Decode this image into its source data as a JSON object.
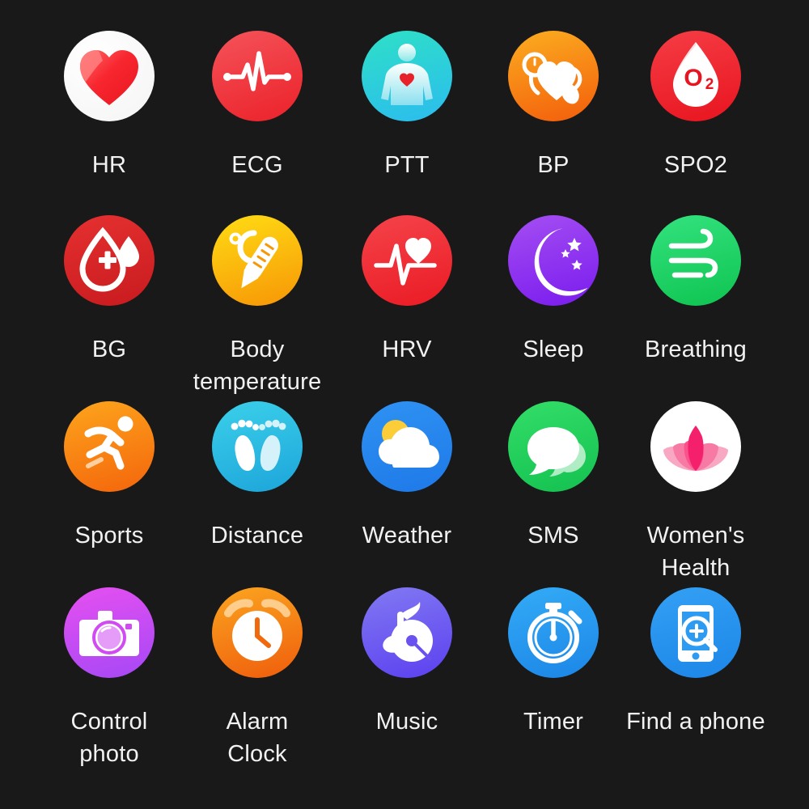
{
  "screen": {
    "title": "Smartwatch Feature Icon Grid",
    "background_color": "#191919",
    "label_color": "#f2f2f2",
    "columns": 5,
    "rows": 4
  },
  "items": [
    {
      "label": "HR",
      "icon": "heart-icon",
      "circle_colors": [
        "#ffffff",
        "#f2f2f2"
      ],
      "glyph_color": "#f42a32"
    },
    {
      "label": "ECG",
      "icon": "ecg-waveform-icon",
      "circle_colors": [
        "#f4464c",
        "#ec2b34"
      ],
      "glyph_color": "#ffffff"
    },
    {
      "label": "PTT",
      "icon": "body-torso-heart-icon",
      "circle_colors": [
        "#2fd9c8",
        "#2ec5ef"
      ],
      "glyph_color": "#ffffff"
    },
    {
      "label": "BP",
      "icon": "blood-pressure-cuff-heart-icon",
      "circle_colors": [
        "#f7a61b",
        "#f4640d"
      ],
      "glyph_color": "#ffffff"
    },
    {
      "label": "SPO2",
      "icon": "oxygen-droplet-icon",
      "circle_colors": [
        "#f4333c",
        "#ea1c27"
      ],
      "glyph_color": "#ffffff"
    },
    {
      "label": "BG",
      "icon": "blood-glucose-droplet-icon",
      "circle_colors": [
        "#e02c2c",
        "#cc1f22"
      ],
      "glyph_color": "#ffffff"
    },
    {
      "label": "Body\ntemperature",
      "icon": "thermometer-icon",
      "circle_colors": [
        "#ffd815",
        "#f79b06"
      ],
      "glyph_color": "#ffffff"
    },
    {
      "label": "HRV",
      "icon": "hrv-pulse-heart-icon",
      "circle_colors": [
        "#f4373f",
        "#ec1f28"
      ],
      "glyph_color": "#ffffff"
    },
    {
      "label": "Sleep",
      "icon": "moon-stars-icon",
      "circle_colors": [
        "#a04cf0",
        "#7a1ff0"
      ],
      "glyph_color": "#ffffff"
    },
    {
      "label": "Breathing",
      "icon": "wind-breathing-icon",
      "circle_colors": [
        "#2fe07a",
        "#11c552"
      ],
      "glyph_color": "#ffffff"
    },
    {
      "label": "Sports",
      "icon": "running-person-icon",
      "circle_colors": [
        "#fba01b",
        "#f5690c"
      ],
      "glyph_color": "#ffffff"
    },
    {
      "label": "Distance",
      "icon": "footprints-icon",
      "circle_colors": [
        "#36cbe8",
        "#1fa9db"
      ],
      "glyph_color": "#ffffff"
    },
    {
      "label": "Weather",
      "icon": "sun-cloud-icon",
      "circle_colors": [
        "#2a8cf0",
        "#1f7ae8"
      ],
      "glyph_color": "#ffffff"
    },
    {
      "label": "SMS",
      "icon": "chat-bubbles-icon",
      "circle_colors": [
        "#2ed964",
        "#16c452"
      ],
      "glyph_color": "#ffffff"
    },
    {
      "label": "Women's\nHealth",
      "icon": "lotus-flower-icon",
      "circle_colors": [
        "#ffffff",
        "#fdf3f6"
      ],
      "glyph_color": "#f52b6b"
    },
    {
      "label": "Control\nphoto",
      "icon": "camera-icon",
      "circle_colors": [
        "#e24cf0",
        "#a94cf5"
      ],
      "glyph_color": "#ffffff"
    },
    {
      "label": "Alarm\nClock",
      "icon": "alarm-clock-icon",
      "circle_colors": [
        "#f9a21b",
        "#f0600d"
      ],
      "glyph_color": "#ffffff"
    },
    {
      "label": "Music",
      "icon": "music-note-disc-icon",
      "circle_colors": [
        "#7d72f0",
        "#5a3ff0"
      ],
      "glyph_color": "#ffffff"
    },
    {
      "label": "Timer",
      "icon": "stopwatch-icon",
      "circle_colors": [
        "#2fa8f5",
        "#1e8ae8"
      ],
      "glyph_color": "#ffffff"
    },
    {
      "label": "Find a phone",
      "icon": "find-phone-icon",
      "circle_colors": [
        "#2e9bf2",
        "#1e8ae8"
      ],
      "glyph_color": "#ffffff"
    }
  ]
}
